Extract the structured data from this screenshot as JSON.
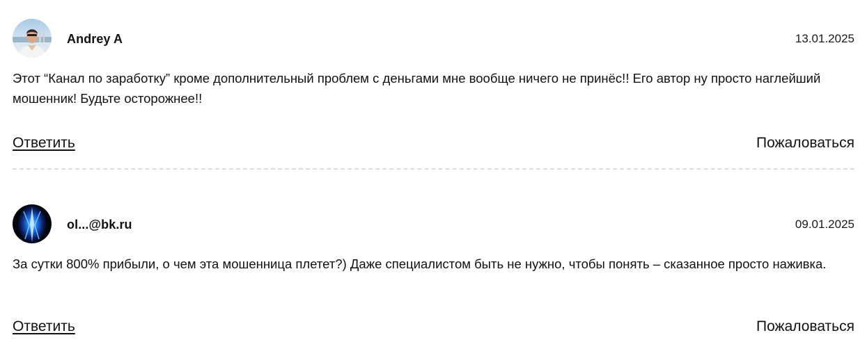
{
  "comments": [
    {
      "author": "Andrey A",
      "date": "13.01.2025",
      "text": "Этот “Канал по заработку” кроме дополнительный проблем с деньгами мне вообще ничего не принёс!! Его автор ну просто наглейший мошенник! Будьте осторожнее!!",
      "reply_label": "Ответить",
      "report_label": "Пожаловаться",
      "avatar_icon": "user-photo-avatar"
    },
    {
      "author": "ol...@bk.ru",
      "date": "09.01.2025",
      "text": "За сутки 800% прибыли, о чем эта мошенница плетет?) Даже специалистом быть не нужно, чтобы понять – сказанное просто наживка.",
      "reply_label": "Ответить",
      "report_label": "Пожаловаться",
      "avatar_icon": "abstract-blue-avatar"
    }
  ]
}
